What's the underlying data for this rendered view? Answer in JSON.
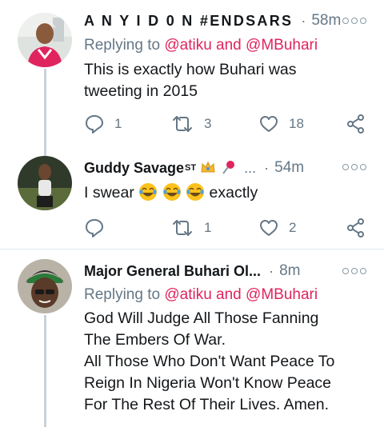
{
  "tweets": [
    {
      "author": "A N Y I D 0 N #ENDSARS",
      "separator": "·",
      "time": "58m",
      "replying_prefix": "Replying to",
      "reply_mention_1": "@atiku",
      "reply_and": "and",
      "reply_mention_2": "@MBuhari",
      "text_line_1": "This is exactly how Buhari was",
      "text_line_2": "tweeting in 2015",
      "reply_count": "1",
      "retweet_count": "3",
      "like_count": "18"
    },
    {
      "author": "Guddy Savage",
      "author_suffix": "ST",
      "name_ellipsis": "...",
      "separator": "·",
      "time": "54m",
      "text_start": "I swear",
      "text_end": "exactly",
      "reply_count": "",
      "retweet_count": "1",
      "like_count": "2"
    },
    {
      "author": "Major General Buhari Ol...",
      "separator": "·",
      "time": "8m",
      "replying_prefix": "Replying to",
      "reply_mention_1": "@atiku",
      "reply_and": "and",
      "reply_mention_2": "@MBuhari",
      "text_lines": [
        "God Will Judge All Those Fanning",
        "The Embers Of War.",
        "All Those Who Don't Want Peace To",
        "Reign In Nigeria Won't Know Peace",
        "For The Rest Of Their Lives. Amen."
      ]
    }
  ],
  "colors": {
    "mention": "#e0245e",
    "secondary": "#657786",
    "thread_line": "#c8d2da",
    "divider": "#e1e8ed"
  },
  "icons": [
    "reply-icon",
    "retweet-icon",
    "like-icon",
    "share-icon",
    "more-icon",
    "emoji-joy-icon",
    "pin-icon",
    "crown-icon"
  ]
}
